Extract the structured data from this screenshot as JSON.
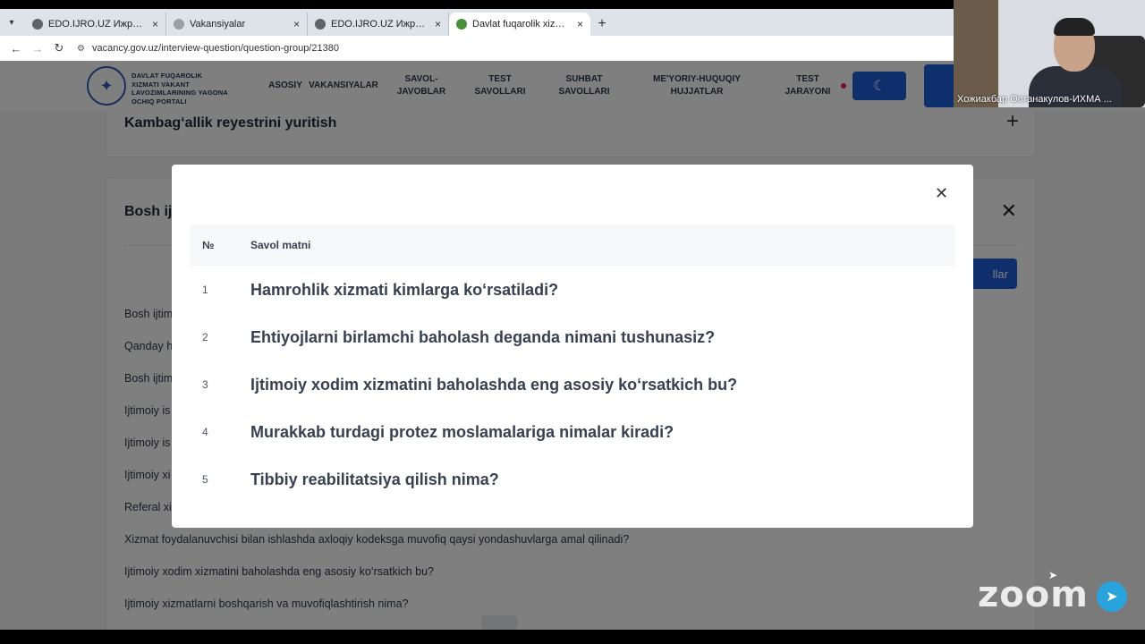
{
  "browser": {
    "tabs": [
      {
        "title": "EDO.IJRO.UZ Ижро интизоми -",
        "active": false,
        "favicon_color": "#5f6368"
      },
      {
        "title": "Vakansiyalar",
        "active": false,
        "favicon_color": "#9aa0a6"
      },
      {
        "title": "EDO.IJRO.UZ Ижро интизоми -",
        "active": false,
        "favicon_color": "#5f6368"
      },
      {
        "title": "Davlat fuqarolik xizmatchilari va",
        "active": true,
        "favicon_color": "#4a8f3a"
      }
    ],
    "tab_close_glyph": "×",
    "new_tab_glyph": "+",
    "url": "vacancy.gov.uz/interview-question/question-group/21380"
  },
  "site": {
    "logo_text": "DAVLAT FUQAROLIK XIZMATI VAKANT LAVOZIMLARINING YAGONA OCHIQ PORTALI",
    "nav": [
      {
        "label": "ASOSIY"
      },
      {
        "label": "VAKANSIYALAR"
      },
      {
        "label": "SAVOL-JAVOBLAR"
      },
      {
        "label": "TEST SAVOLLARI"
      },
      {
        "label": "SUHBAT SAVOLLARI"
      },
      {
        "label": "ME'YORIY-HUQUQIY HUJJATLAR"
      },
      {
        "label": "TEST JARAYONI"
      }
    ]
  },
  "accordion": {
    "item1_title": "Kambag‘allik reyestrini yuritish",
    "item2_title": "Bosh ijti",
    "button_label": "llar",
    "questions": [
      "Bosh ijtim",
      "Qanday h",
      "Bosh ijtim",
      "Ijtimoiy is",
      "Ijtimoiy is",
      "Ijtimoiy xi",
      "Referal xi",
      "Xizmat foydalanuvchisi bilan ishlashda axloqiy kodeksga muvofiq qaysi yondashuvlarga amal qilinadi?",
      "Ijtimoiy xodim xizmatini baholashda eng asosiy ko‘rsatkich bu?",
      "Ijtimoiy xizmatlarni boshqarish va muvofiqlashtirish nima?"
    ]
  },
  "modal": {
    "col_num": "№",
    "col_text": "Savol matni",
    "rows": [
      {
        "num": "1",
        "text": "Hamrohlik xizmati kimlarga ko‘rsatiladi?"
      },
      {
        "num": "2",
        "text": "Ehtiyojlarni birlamchi baholash deganda nimani tushunasiz?"
      },
      {
        "num": "3",
        "text": "Ijtimoiy xodim xizmatini baholashda eng asosiy ko‘rsatkich bu?"
      },
      {
        "num": "4",
        "text": "Murakkab turdagi protez moslamalariga nimalar kiradi?"
      },
      {
        "num": "5",
        "text": "Tibbiy reabilitatsiya qilish nima?"
      }
    ]
  },
  "zoom": {
    "participant_name": "Хожиакбар Останакулов-ИХМА ...",
    "logo": "zoom"
  },
  "colors": {
    "primary": "#1d5fd6",
    "overlay": "rgba(0,0,0,0.5)"
  }
}
